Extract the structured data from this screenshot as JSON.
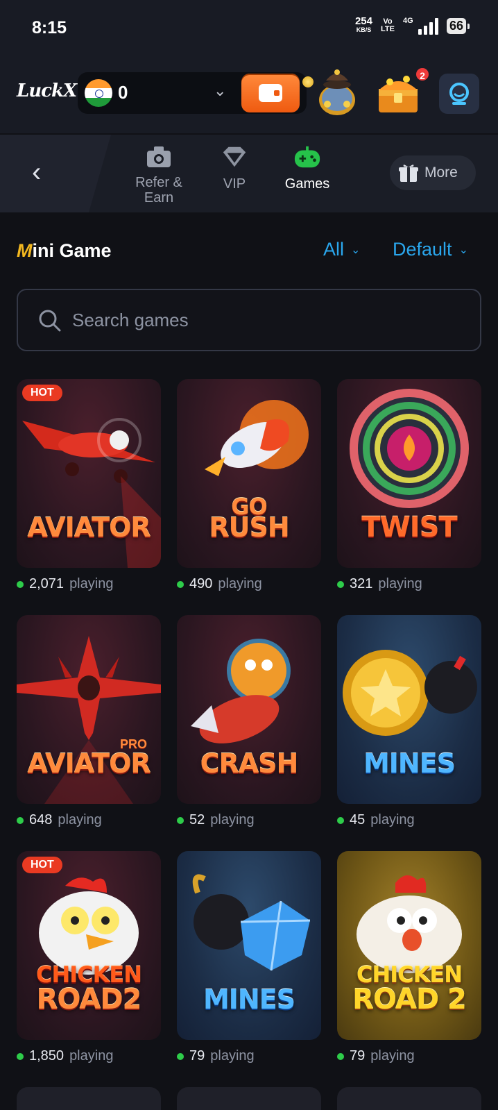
{
  "status_bar": {
    "time": "8:15",
    "speed": "254",
    "speed_unit": "KB/S",
    "volte_top": "Vo",
    "volte_bottom": "LTE",
    "network": "4G",
    "battery": "66"
  },
  "header": {
    "logo": "LuckX",
    "balance": "0",
    "notification_count": "2"
  },
  "nav": {
    "items": [
      {
        "label": "Refer &",
        "label2": "Earn",
        "icon": "camera-gift-icon"
      },
      {
        "label": "VIP",
        "icon": "diamond-icon"
      },
      {
        "label": "Games",
        "icon": "gamepad-icon",
        "active": true
      }
    ],
    "more_label": "More"
  },
  "section": {
    "title_first": "M",
    "title_rest": "ini Game",
    "filter_all": "All",
    "filter_sort": "Default"
  },
  "search": {
    "placeholder": "Search games"
  },
  "playing_label": "playing",
  "games": [
    {
      "title": "AVIATOR",
      "count": "2,071",
      "hot": "HOT"
    },
    {
      "title": "GO",
      "title2": "RUSH",
      "count": "490"
    },
    {
      "title": "TWIST",
      "count": "321"
    },
    {
      "title": "AVIATOR",
      "tag": "PRO",
      "count": "648"
    },
    {
      "title": "CRASH",
      "count": "52"
    },
    {
      "title": "MINES",
      "count": "45"
    },
    {
      "title": "CHICKEN",
      "title2": "ROAD2",
      "count": "1,850",
      "hot": "HOT"
    },
    {
      "title": "MINES",
      "count": "79"
    },
    {
      "title": "CHICKEN",
      "title2": "ROAD 2",
      "count": "79"
    }
  ],
  "colors": {
    "accent_blue": "#2aa7ee",
    "wallet_orange": "#ef5a10",
    "online_green": "#2ecc4a",
    "hot_red": "#ea3a22"
  }
}
